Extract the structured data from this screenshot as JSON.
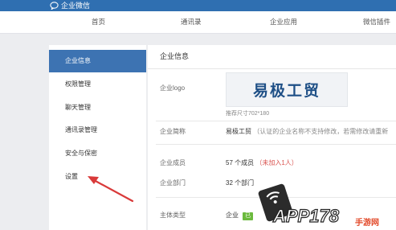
{
  "header": {
    "brand": "企业微信"
  },
  "nav": {
    "items": [
      "首页",
      "通讯录",
      "企业应用",
      "微信插件"
    ]
  },
  "sidebar": {
    "items": [
      "企业信息",
      "权限管理",
      "聊天管理",
      "通讯录管理",
      "安全与保密",
      "设置"
    ]
  },
  "main": {
    "title": "企业信息",
    "logo_label": "企业logo",
    "logo_text": "易极工贸",
    "logo_hint": "推荐尺寸702*180",
    "shortname_label": "企业简称",
    "shortname_value": "易极工贸",
    "shortname_note": "（认证的企业名称不支持修改，若需修改请重新",
    "members_label": "企业成员",
    "members_value": "57 个成员",
    "members_note": "（未加入1人）",
    "depts_label": "企业部门",
    "depts_value": "32 个部门",
    "type_label": "主体类型",
    "type_value": "企业",
    "type_badge": "已"
  },
  "watermark": {
    "text": "APP178",
    "site": "手游网"
  },
  "colors": {
    "header": "#2f6fb1",
    "active": "#3d73b2",
    "arrow": "#d93a3a",
    "badge": "#6cba3e"
  },
  "icons": {
    "brand": "chat-bubble-icon",
    "arrow": "annotation-arrow"
  }
}
